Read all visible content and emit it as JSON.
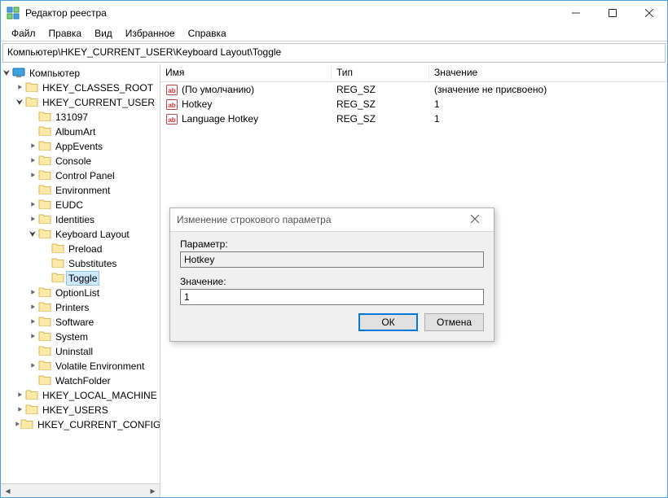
{
  "window": {
    "title": "Редактор реестра"
  },
  "title_buttons": {
    "min": "minimize",
    "max": "maximize",
    "close": "close"
  },
  "menubar": [
    "Файл",
    "Правка",
    "Вид",
    "Избранное",
    "Справка"
  ],
  "addressbar": "Компьютер\\HKEY_CURRENT_USER\\Keyboard Layout\\Toggle",
  "tree": [
    {
      "label": "Компьютер",
      "indent": 0,
      "icon": "pc",
      "twisty": "open"
    },
    {
      "label": "HKEY_CLASSES_ROOT",
      "indent": 1,
      "icon": "folder",
      "twisty": "closed"
    },
    {
      "label": "HKEY_CURRENT_USER",
      "indent": 1,
      "icon": "folder",
      "twisty": "open"
    },
    {
      "label": "131097",
      "indent": 2,
      "icon": "folder",
      "twisty": "none"
    },
    {
      "label": "AlbumArt",
      "indent": 2,
      "icon": "folder",
      "twisty": "none"
    },
    {
      "label": "AppEvents",
      "indent": 2,
      "icon": "folder",
      "twisty": "closed"
    },
    {
      "label": "Console",
      "indent": 2,
      "icon": "folder",
      "twisty": "closed"
    },
    {
      "label": "Control Panel",
      "indent": 2,
      "icon": "folder",
      "twisty": "closed"
    },
    {
      "label": "Environment",
      "indent": 2,
      "icon": "folder",
      "twisty": "none"
    },
    {
      "label": "EUDC",
      "indent": 2,
      "icon": "folder",
      "twisty": "closed"
    },
    {
      "label": "Identities",
      "indent": 2,
      "icon": "folder",
      "twisty": "closed"
    },
    {
      "label": "Keyboard Layout",
      "indent": 2,
      "icon": "folder",
      "twisty": "open"
    },
    {
      "label": "Preload",
      "indent": 3,
      "icon": "folder",
      "twisty": "none"
    },
    {
      "label": "Substitutes",
      "indent": 3,
      "icon": "folder",
      "twisty": "none"
    },
    {
      "label": "Toggle",
      "indent": 3,
      "icon": "folder",
      "twisty": "none",
      "selected": true
    },
    {
      "label": "OptionList",
      "indent": 2,
      "icon": "folder",
      "twisty": "closed"
    },
    {
      "label": "Printers",
      "indent": 2,
      "icon": "folder",
      "twisty": "closed"
    },
    {
      "label": "Software",
      "indent": 2,
      "icon": "folder",
      "twisty": "closed"
    },
    {
      "label": "System",
      "indent": 2,
      "icon": "folder",
      "twisty": "closed"
    },
    {
      "label": "Uninstall",
      "indent": 2,
      "icon": "folder",
      "twisty": "none"
    },
    {
      "label": "Volatile Environment",
      "indent": 2,
      "icon": "folder",
      "twisty": "closed"
    },
    {
      "label": "WatchFolder",
      "indent": 2,
      "icon": "folder",
      "twisty": "none"
    },
    {
      "label": "HKEY_LOCAL_MACHINE",
      "indent": 1,
      "icon": "folder",
      "twisty": "closed"
    },
    {
      "label": "HKEY_USERS",
      "indent": 1,
      "icon": "folder",
      "twisty": "closed"
    },
    {
      "label": "HKEY_CURRENT_CONFIG",
      "indent": 1,
      "icon": "folder",
      "twisty": "closed"
    }
  ],
  "list": {
    "headers": {
      "name": "Имя",
      "type": "Тип",
      "value": "Значение"
    },
    "rows": [
      {
        "name": "(По умолчанию)",
        "type": "REG_SZ",
        "value": "(значение не присвоено)"
      },
      {
        "name": "Hotkey",
        "type": "REG_SZ",
        "value": "1"
      },
      {
        "name": "Language Hotkey",
        "type": "REG_SZ",
        "value": "1"
      }
    ]
  },
  "dialog": {
    "title": "Изменение строкового параметра",
    "param_label": "Параметр:",
    "param_value": "Hotkey",
    "value_label": "Значение:",
    "value_value": "1",
    "ok": "ОК",
    "cancel": "Отмена"
  }
}
